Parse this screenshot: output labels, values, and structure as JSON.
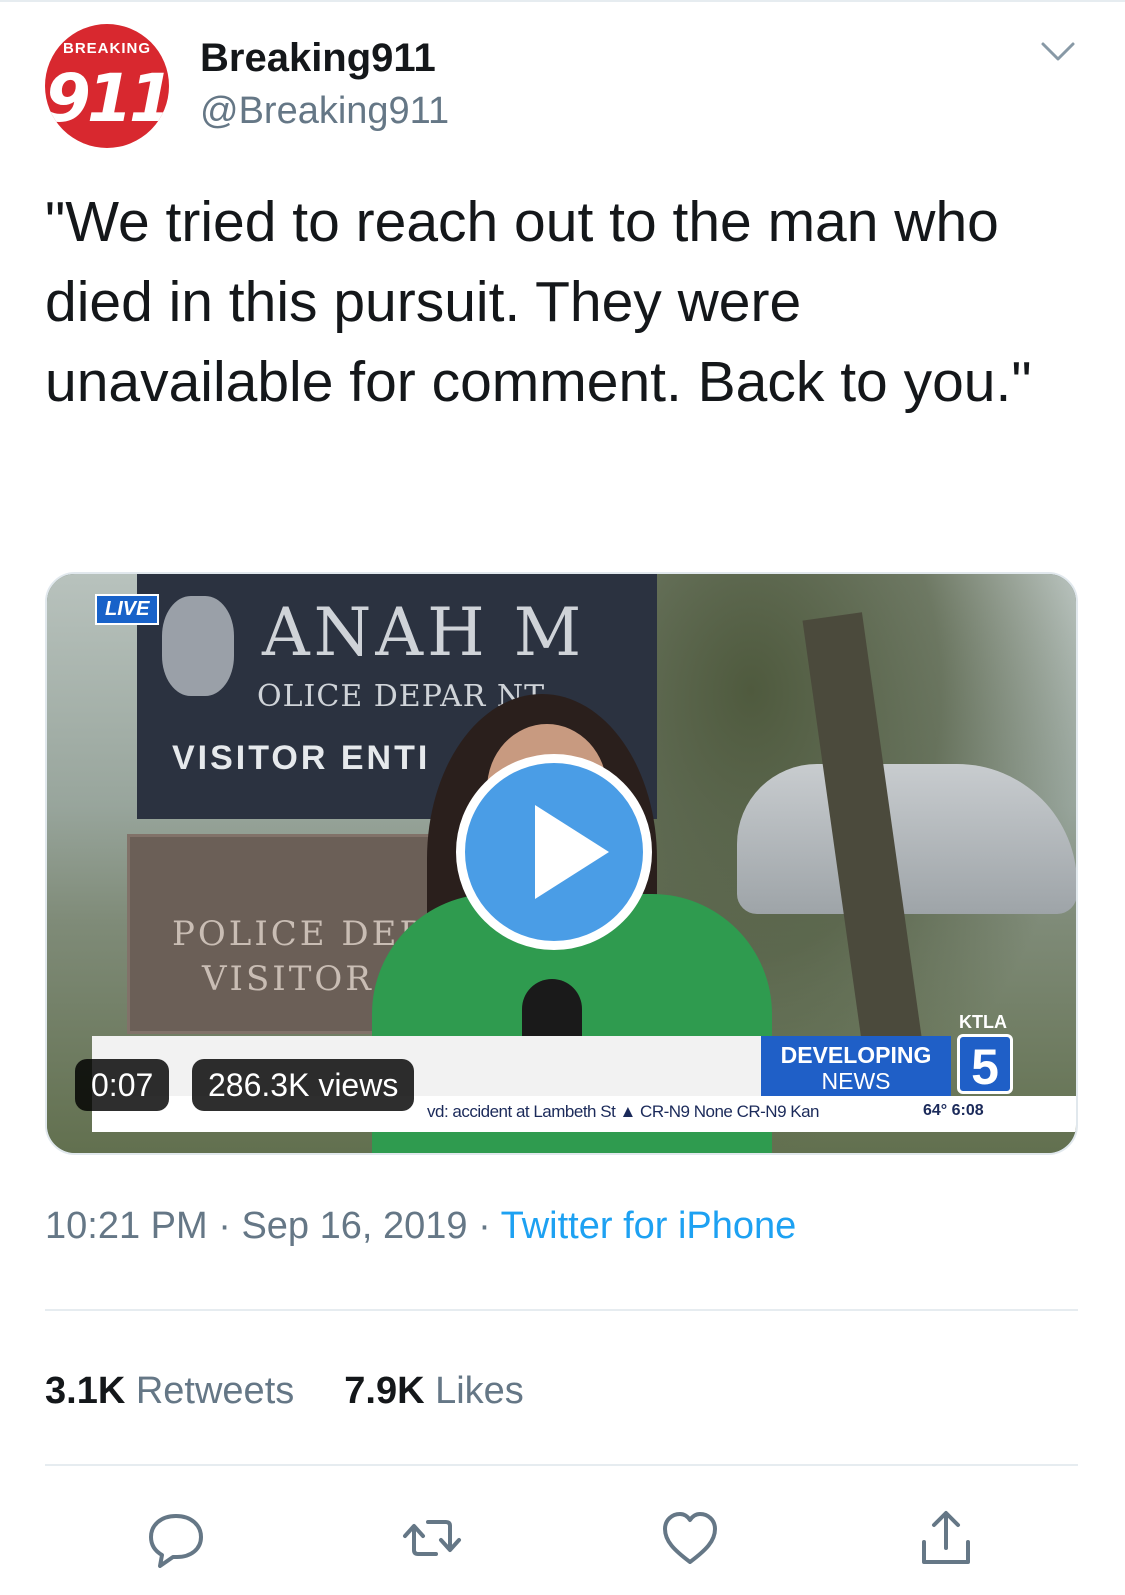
{
  "author": {
    "display_name": "Breaking911",
    "handle": "@Breaking911",
    "avatar_top_text": "BREAKING",
    "avatar_number": "911"
  },
  "tweet": {
    "text": "\"We tried to reach out to the man who died in this pursuit. They were unavailable for comment. Back to you.\""
  },
  "media": {
    "live_label": "LIVE",
    "sign_top": "ANAH M",
    "sign_dept": "OLICE DEPAR NT",
    "sign_visitor": "VISITOR ENTI",
    "sign_lower_1": "POLICE DEP",
    "sign_lower_2": "VISITOR",
    "ticker": "vd: accident at Lambeth St  ▲  CR-N9 None CR-N9 Kan",
    "temp_time": "64°  6:08",
    "developing_1": "DEVELOPING",
    "developing_2": "NEWS",
    "station_word": "KTLA",
    "station_number": "5",
    "duration": "0:07",
    "views": "286.3K views"
  },
  "meta": {
    "time": "10:21 PM",
    "separator": " · ",
    "date": "Sep 16, 2019",
    "source": "Twitter for iPhone"
  },
  "stats": {
    "retweets_count": "3.1K",
    "retweets_label": "Retweets",
    "likes_count": "7.9K",
    "likes_label": "Likes"
  },
  "actions": [
    "reply-icon",
    "retweet-icon",
    "like-icon",
    "share-icon"
  ],
  "colors": {
    "accent": "#1da1f2",
    "text": "#14171a",
    "secondary": "#657786",
    "play_button": "#4a9de6"
  }
}
